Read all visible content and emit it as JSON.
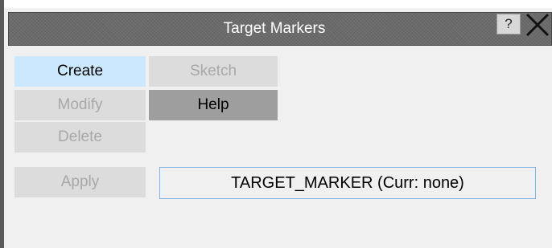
{
  "window": {
    "title": "Target Markers",
    "help_label": "?",
    "close_icon": "close-icon"
  },
  "buttons": {
    "create": "Create",
    "sketch": "Sketch",
    "modify": "Modify",
    "help": "Help",
    "delete": "Delete",
    "apply": "Apply"
  },
  "target_field": {
    "value": "TARGET_MARKER (Curr: none)"
  },
  "colors": {
    "titlebar": "#6b6b6b",
    "selected_button": "#cce8ff",
    "disabled_button": "#dcdcdc",
    "help_button": "#9e9e9e",
    "field_border": "#7fb4e6"
  }
}
